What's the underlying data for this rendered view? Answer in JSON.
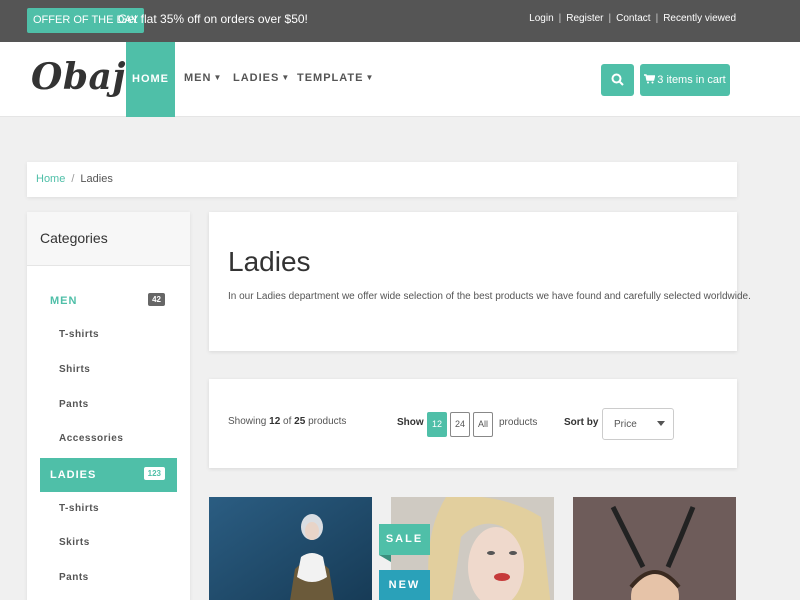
{
  "topbar": {
    "offer_badge": "OFFER OF THE DAY",
    "offer_text": "Get flat 35% off on orders over $50!",
    "links": [
      "Login",
      "Register",
      "Contact",
      "Recently viewed"
    ]
  },
  "nav": {
    "logo": "Obaju",
    "items": [
      {
        "label": "HOME",
        "dropdown": false
      },
      {
        "label": "MEN",
        "dropdown": true
      },
      {
        "label": "LADIES",
        "dropdown": true
      },
      {
        "label": "TEMPLATE",
        "dropdown": true
      }
    ],
    "cart_label": "3 items in cart"
  },
  "breadcrumb": [
    "Home",
    "Ladies"
  ],
  "sidebar": {
    "title": "Categories",
    "men": {
      "label": "MEN",
      "count": "42",
      "items": [
        "T-shirts",
        "Shirts",
        "Pants",
        "Accessories"
      ]
    },
    "ladies": {
      "label": "LADIES",
      "count": "123",
      "items": [
        "T-shirts",
        "Skirts",
        "Pants"
      ]
    }
  },
  "main": {
    "title": "Ladies",
    "description": "In our Ladies department we offer wide selection of the best products we have found and carefully selected worldwide."
  },
  "toolbar": {
    "showing_prefix": "Showing ",
    "showing_count": "12",
    "showing_of": " of ",
    "showing_total": "25",
    "showing_suffix": " products",
    "show_label": "Show",
    "per_page": [
      "12",
      "24",
      "All"
    ],
    "products_label": "products",
    "sort_label": "Sort by",
    "sort_value": "Price"
  },
  "ribbons": {
    "sale": "SALE",
    "new": "NEW"
  },
  "colors": {
    "accent": "#4fbfa8",
    "topbar": "#555555",
    "new_ribbon": "#2aa1b9"
  }
}
